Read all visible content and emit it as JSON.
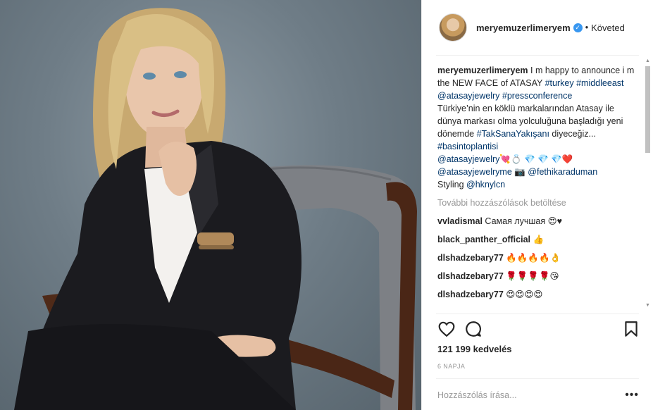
{
  "photo": {
    "alt_icon": "portrait-photo"
  },
  "header": {
    "username": "meryemuzerlimeryem",
    "verified_icon": "verified-badge-icon",
    "separator": "•",
    "follow_status": "Követed"
  },
  "caption": {
    "username": "meryemuzerlimeryem",
    "text1": " I m happy to announce i m the NEW FACE of ATASAY ",
    "tag_turkey": "#turkey",
    "tag_middleeast": "#middleeast",
    "mention_atasayjewelry": "@atasayjewelry",
    "tag_pressconference": "#pressconference",
    "text2": "Türkiye’nin en köklü markalarından Atasay ile dünya markası olma yolculuğuna başladığı yeni dönemde ",
    "tag_taksanayakisani": "#TakSanaYakışanı",
    "text3": " diyeceğiz...",
    "tag_basintoplantisi": "#basintoplantisi",
    "mention_atasayjewelry2": "@atasayjewelry",
    "emojis1": "💘💍 💎 💎 💎❤️",
    "mention_atasayjewelryme": "@atasayjewelryme",
    "camera": " 📷 ",
    "mention_fethikaraduman": "@fethikaraduman",
    "styling_label": "Styling ",
    "mention_hknylcn": "@hknylcn"
  },
  "load_more": "További hozzászólások betöltése",
  "comments": [
    {
      "user": "vvladismal",
      "text": " Самая лучшая 😍♥"
    },
    {
      "user": "black_panther_official",
      "text": " 👍"
    },
    {
      "user": "dlshadzebary77",
      "text": " 🔥🔥🔥🔥👌"
    },
    {
      "user": "dlshadzebary77",
      "text": " 🌹🌹🌹🌹😘"
    },
    {
      "user": "dlshadzebary77",
      "text": " 😍😍😍😍"
    }
  ],
  "actions": {
    "like_icon": "heart-icon",
    "comment_icon": "comment-icon",
    "save_icon": "bookmark-icon"
  },
  "likes": "121 199 kedvelés",
  "time_ago": "6 NAPJA",
  "comment_input": {
    "placeholder": "Hozzászólás írása..."
  },
  "more_icon": "more-options-icon",
  "more_label": "•••"
}
